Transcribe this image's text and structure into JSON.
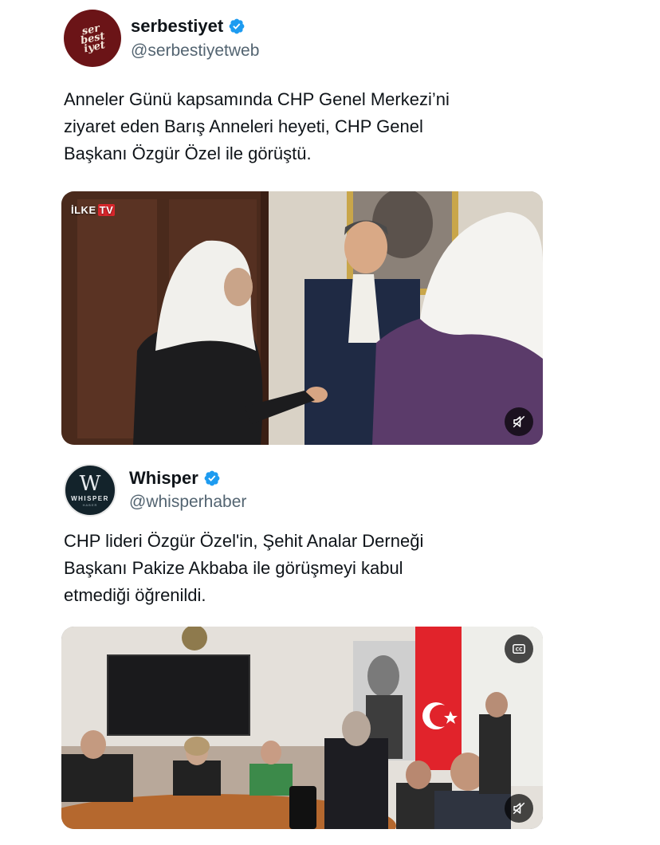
{
  "tweets": [
    {
      "display_name": "serbestiyet",
      "handle": "@serbestiyetweb",
      "avatar_text": "ser\nbest\niyet",
      "text": "Anneler Günü kapsamında CHP Genel Merkezi’ni\nziyaret eden Barış Anneleri heyeti, CHP Genel\nBaşkanı Özgür Özel ile görüştü.",
      "media": {
        "type": "video",
        "watermark": "İLKE",
        "watermark_tv": "TV",
        "control_icon": "mute-icon"
      }
    },
    {
      "display_name": "Whisper",
      "handle": "@whisperhaber",
      "avatar_letter": "W",
      "avatar_word": "WHISPER",
      "avatar_sub": "HABER",
      "text": "CHP lideri Özgür Özel'in, Şehit Analar Derneği\nBaşkanı Pakize Akbaba ile görüşmeyi kabul\netmediği öğrenildi.",
      "media": {
        "type": "video",
        "top_control_icon": "closed-captions-icon",
        "control_icon": "mute-icon"
      }
    }
  ],
  "colors": {
    "verified": "#1d9bf0",
    "text": "#0f1419",
    "secondary": "#536471"
  }
}
